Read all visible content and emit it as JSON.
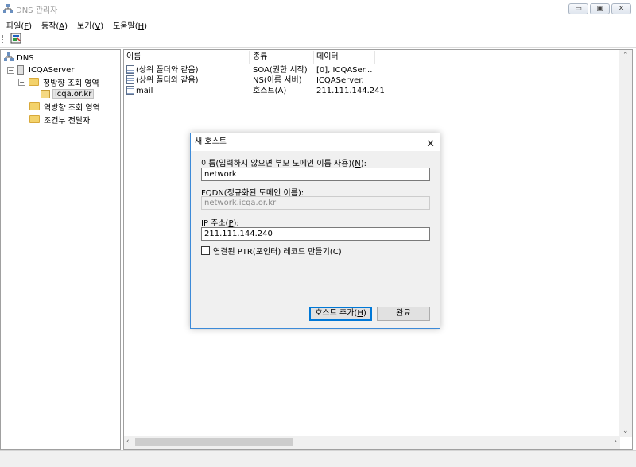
{
  "window": {
    "title": "DNS 관리자"
  },
  "menu": [
    {
      "label": "파일",
      "key": "F"
    },
    {
      "label": "동작",
      "key": "A"
    },
    {
      "label": "보기",
      "key": "V"
    },
    {
      "label": "도움말",
      "key": "H"
    }
  ],
  "tree": {
    "root": "DNS",
    "server": "ICQAServer",
    "forward_zones": "정방향 조회 영역",
    "zone": "icqa.or.kr",
    "reverse_zones": "역방향 조회 영역",
    "forwarders": "조건부 전달자"
  },
  "list": {
    "columns": [
      "이름",
      "종류",
      "데이터"
    ],
    "rows": [
      {
        "name": "(상위 폴더와 같음)",
        "type": "SOA(권한 시작)",
        "data": "[0], ICQASer..."
      },
      {
        "name": "(상위 폴더와 같음)",
        "type": "NS(이름 서버)",
        "data": "ICQAServer."
      },
      {
        "name": "mail",
        "type": "호스트(A)",
        "data": "211.111.144.241"
      }
    ]
  },
  "dialog": {
    "title": "새 호스트",
    "name_label": "이름(입력하지 않으면 부모 도메인 이름 사용)(",
    "name_key": "N",
    "name_label_end": "):",
    "name_value": "network",
    "fqdn_label": "FQDN(정규화된 도메인 이름):",
    "fqdn_value": "network.icqa.or.kr",
    "ip_label": "IP 주소(",
    "ip_key": "P",
    "ip_label_end": "):",
    "ip_value": "211.111.144.240",
    "ptr_label": "연결된 PTR(포인터) 레코드 만들기(C)",
    "add_button": "호스트 추가(",
    "add_key": "H",
    "add_button_end": ")",
    "done_button": "완료"
  }
}
